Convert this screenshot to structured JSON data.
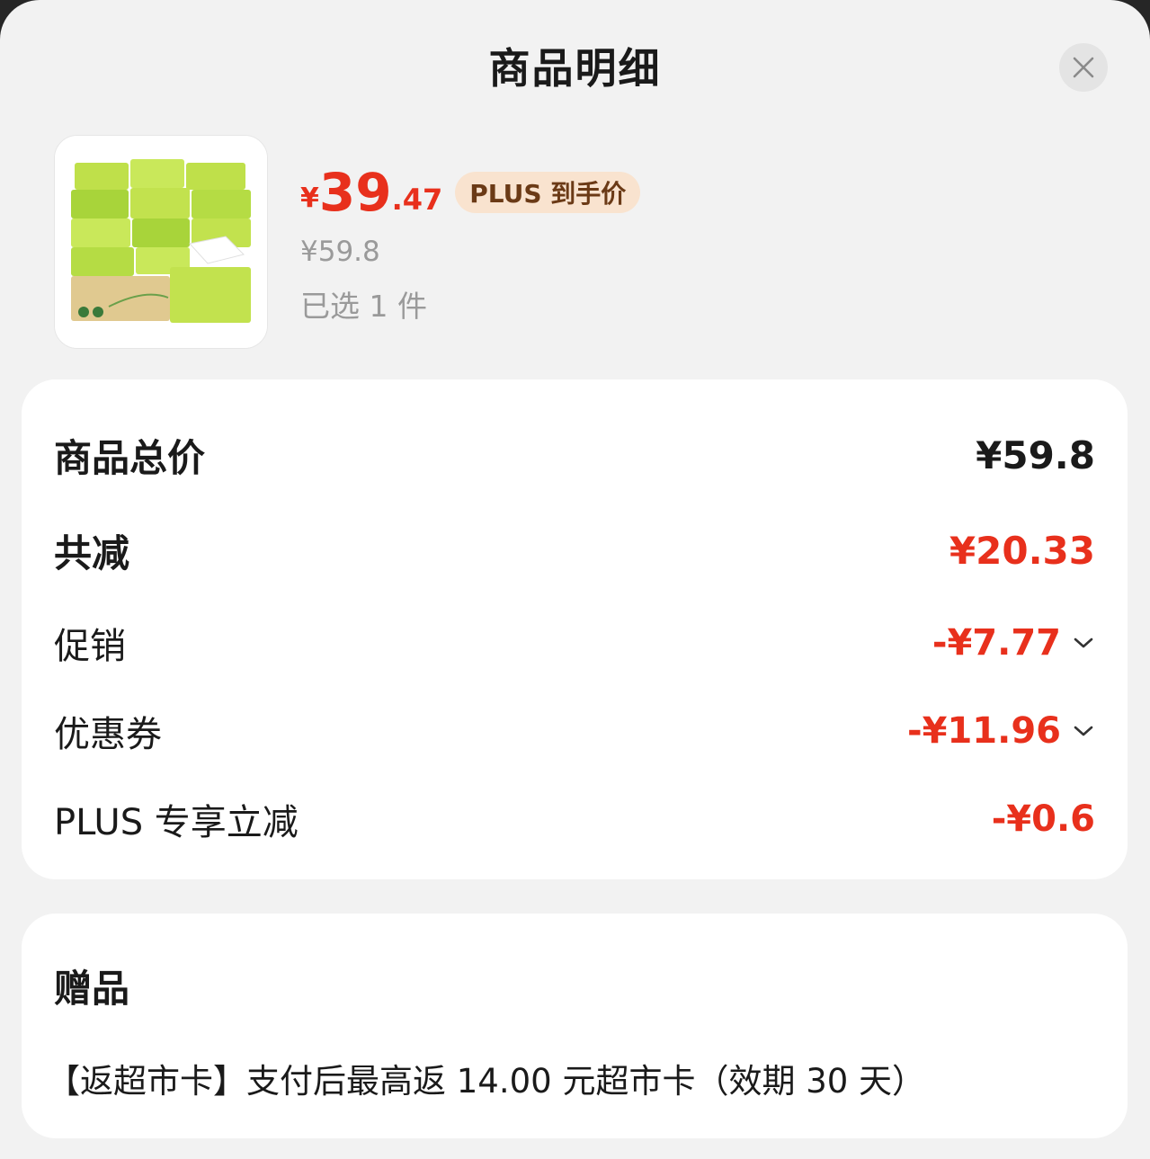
{
  "header": {
    "title": "商品明细",
    "close_icon": "close-icon"
  },
  "product": {
    "image_icon": "tissue-product-image",
    "price_currency": "¥",
    "price_integer": "39",
    "price_decimal": ".47",
    "plus_badge": "PLUS 到手价",
    "original_price": "¥59.8",
    "selected_qty": "已选 1 件"
  },
  "summary": {
    "total_label": "商品总价",
    "total_value": "¥59.8",
    "reduce_label": "共减",
    "reduce_value": "¥20.33",
    "promo_label": "促销",
    "promo_value": "-¥7.77",
    "coupon_label": "优惠券",
    "coupon_value": "-¥11.96",
    "plus_label": "PLUS 专享立减",
    "plus_value": "-¥0.6"
  },
  "gift": {
    "title": "赠品",
    "text": "【返超市卡】支付后最高返 14.00 元超市卡（效期 30 天）"
  },
  "colors": {
    "accent_red": "#e8301c",
    "badge_bg": "#f9e3cf",
    "badge_text": "#6b3a16"
  }
}
